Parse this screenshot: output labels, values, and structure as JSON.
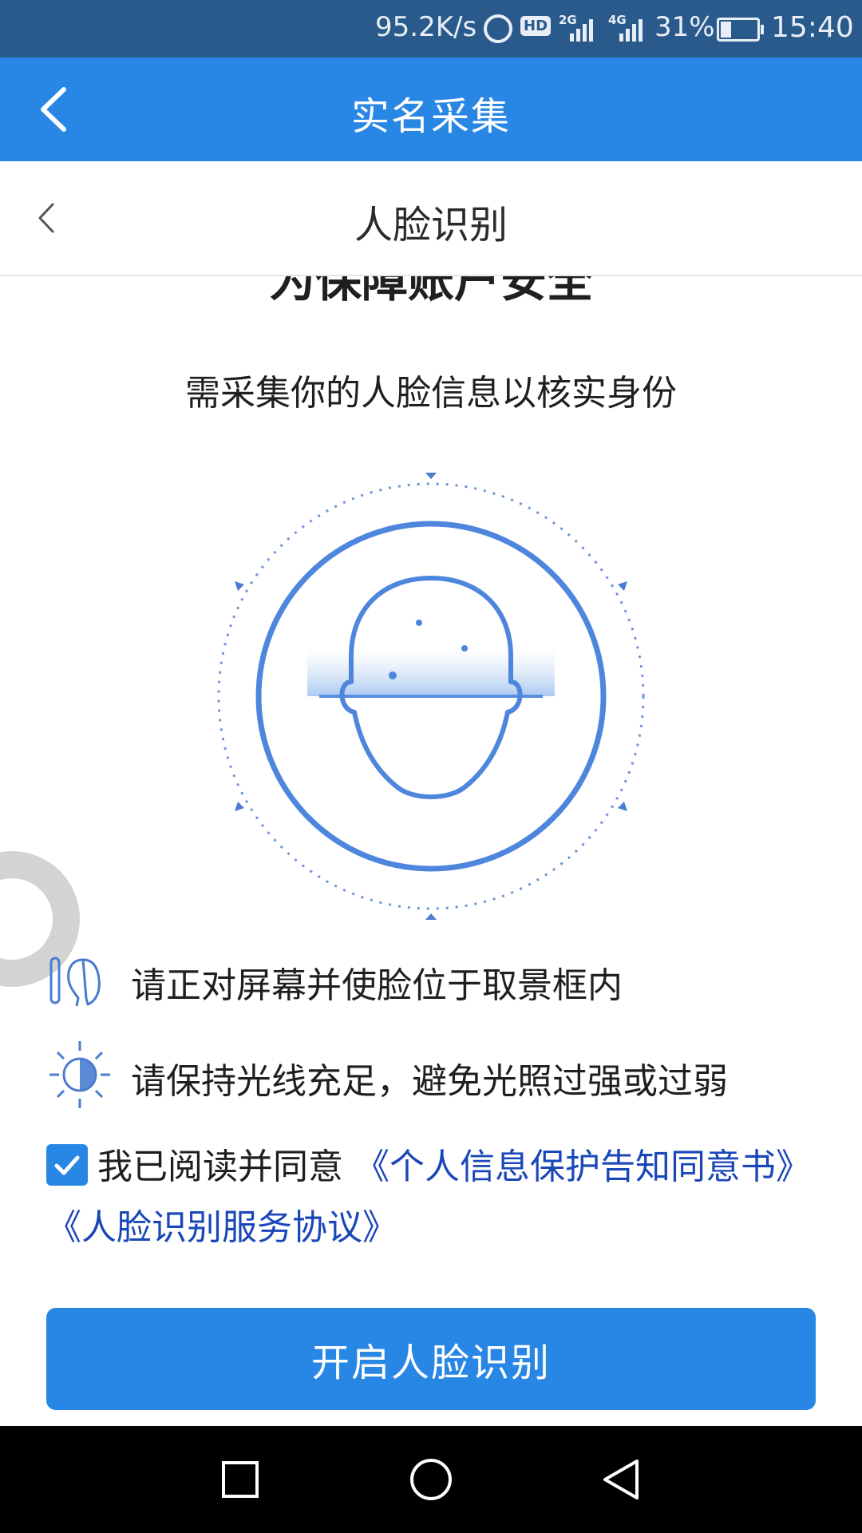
{
  "status_bar": {
    "net_speed": "95.2K/s",
    "hd_badge": "HD",
    "sim1_network": "2G",
    "sim2_network": "4G",
    "battery_percent": "31%",
    "time": "15:40",
    "battery_level": 0.31
  },
  "app_bar": {
    "title": "实名采集",
    "back_icon": "chevron-left-icon"
  },
  "sub_bar": {
    "title": "人脸识别",
    "back_icon": "chevron-left-icon"
  },
  "main": {
    "heading": "为保障账户安全",
    "subheading": "需采集你的人脸信息以核实身份",
    "illustration_icon": "face-scan-icon",
    "tips": [
      {
        "icon": "face-position-icon",
        "text": "请正对屏幕并使脸位于取景框内"
      },
      {
        "icon": "light-icon",
        "text": "请保持光线充足，避免光照过强或过弱"
      }
    ],
    "agreement": {
      "checked": true,
      "prefix": "我已阅读并同意",
      "link1": "《个人信息保护告知同意书》",
      "link2": "《人脸识别服务协议》"
    },
    "start_button": "开启人脸识别"
  },
  "nav_bar": {
    "icons": [
      "square-icon",
      "circle-icon",
      "triangle-back-icon"
    ]
  },
  "colors": {
    "primary": "#2886e4",
    "status_bar": "#2a5a8c",
    "link": "#1a47b8"
  }
}
